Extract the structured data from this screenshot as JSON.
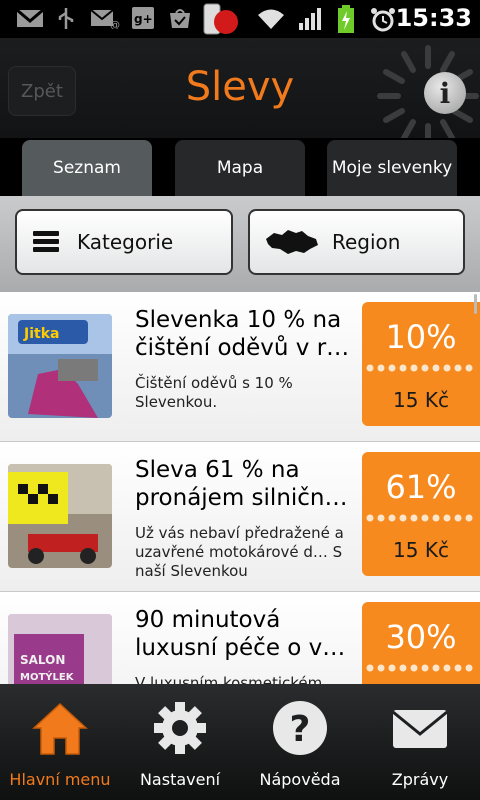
{
  "status_bar": {
    "time": "15:33"
  },
  "header": {
    "back_label": "Zpět",
    "title": "Slevy"
  },
  "tabs": [
    {
      "label": "Seznam",
      "active": true
    },
    {
      "label": "Mapa",
      "active": false
    },
    {
      "label": "Moje slevenky",
      "active": false
    }
  ],
  "filters": {
    "category_label": "Kategorie",
    "region_label": "Region"
  },
  "deals": [
    {
      "title": "Slevenka 10 % na čištění oděvů v r…",
      "description": "Čištění oděvů s 10 % Slevenkou.",
      "percent": "10%",
      "price": "15 Kč"
    },
    {
      "title": "Sleva 61 % na pronájem silničn…",
      "description": "Už vás nebaví předražené a uzavřené motokárové d… S naší Slevenkou",
      "percent": "61%",
      "price": "15 Kč"
    },
    {
      "title": "90 minutová luxusní péče o v…",
      "description": "V luxusním kosmetickém…",
      "percent": "30%",
      "price": ""
    }
  ],
  "bottom_nav": [
    {
      "label": "Hlavní menu",
      "icon": "home-icon",
      "active": true
    },
    {
      "label": "Nastavení",
      "icon": "gear-icon",
      "active": false
    },
    {
      "label": "Nápověda",
      "icon": "help-icon",
      "active": false
    },
    {
      "label": "Zprávy",
      "icon": "mail-icon",
      "active": false
    }
  ],
  "colors": {
    "accent": "#f07a1c",
    "coupon": "#f78a1e"
  }
}
